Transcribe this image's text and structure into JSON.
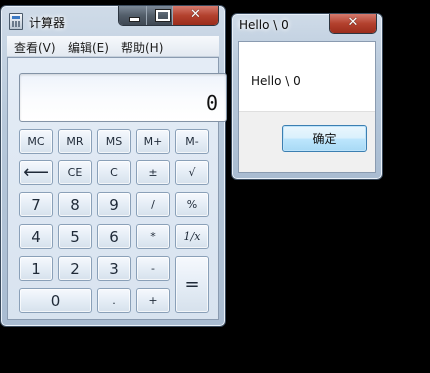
{
  "calculator": {
    "title": "计算器",
    "menu": [
      "查看(V)",
      "编辑(E)",
      "帮助(H)"
    ],
    "display_value": "0",
    "window_controls": {
      "minimize_icon": "minimize-icon",
      "maximize_icon": "maximize-icon",
      "close_glyph": "✕"
    },
    "keys": {
      "mc": "MC",
      "mr": "MR",
      "ms": "MS",
      "mplus": "M+",
      "mminus": "M-",
      "backspace": "⟵",
      "ce": "CE",
      "c": "C",
      "plusminus": "±",
      "sqrt": "√",
      "d7": "7",
      "d8": "8",
      "d9": "9",
      "div": "/",
      "percent": "%",
      "d4": "4",
      "d5": "5",
      "d6": "6",
      "mul": "*",
      "reciprocal": "1/x",
      "d1": "1",
      "d2": "2",
      "d3": "3",
      "sub": "-",
      "equals": "=",
      "d0": "0",
      "dot": ".",
      "add": "+"
    }
  },
  "dialog": {
    "title": "Hello \\ 0",
    "message": "Hello \\ 0",
    "ok_label": "确定",
    "close_glyph": "✕"
  }
}
